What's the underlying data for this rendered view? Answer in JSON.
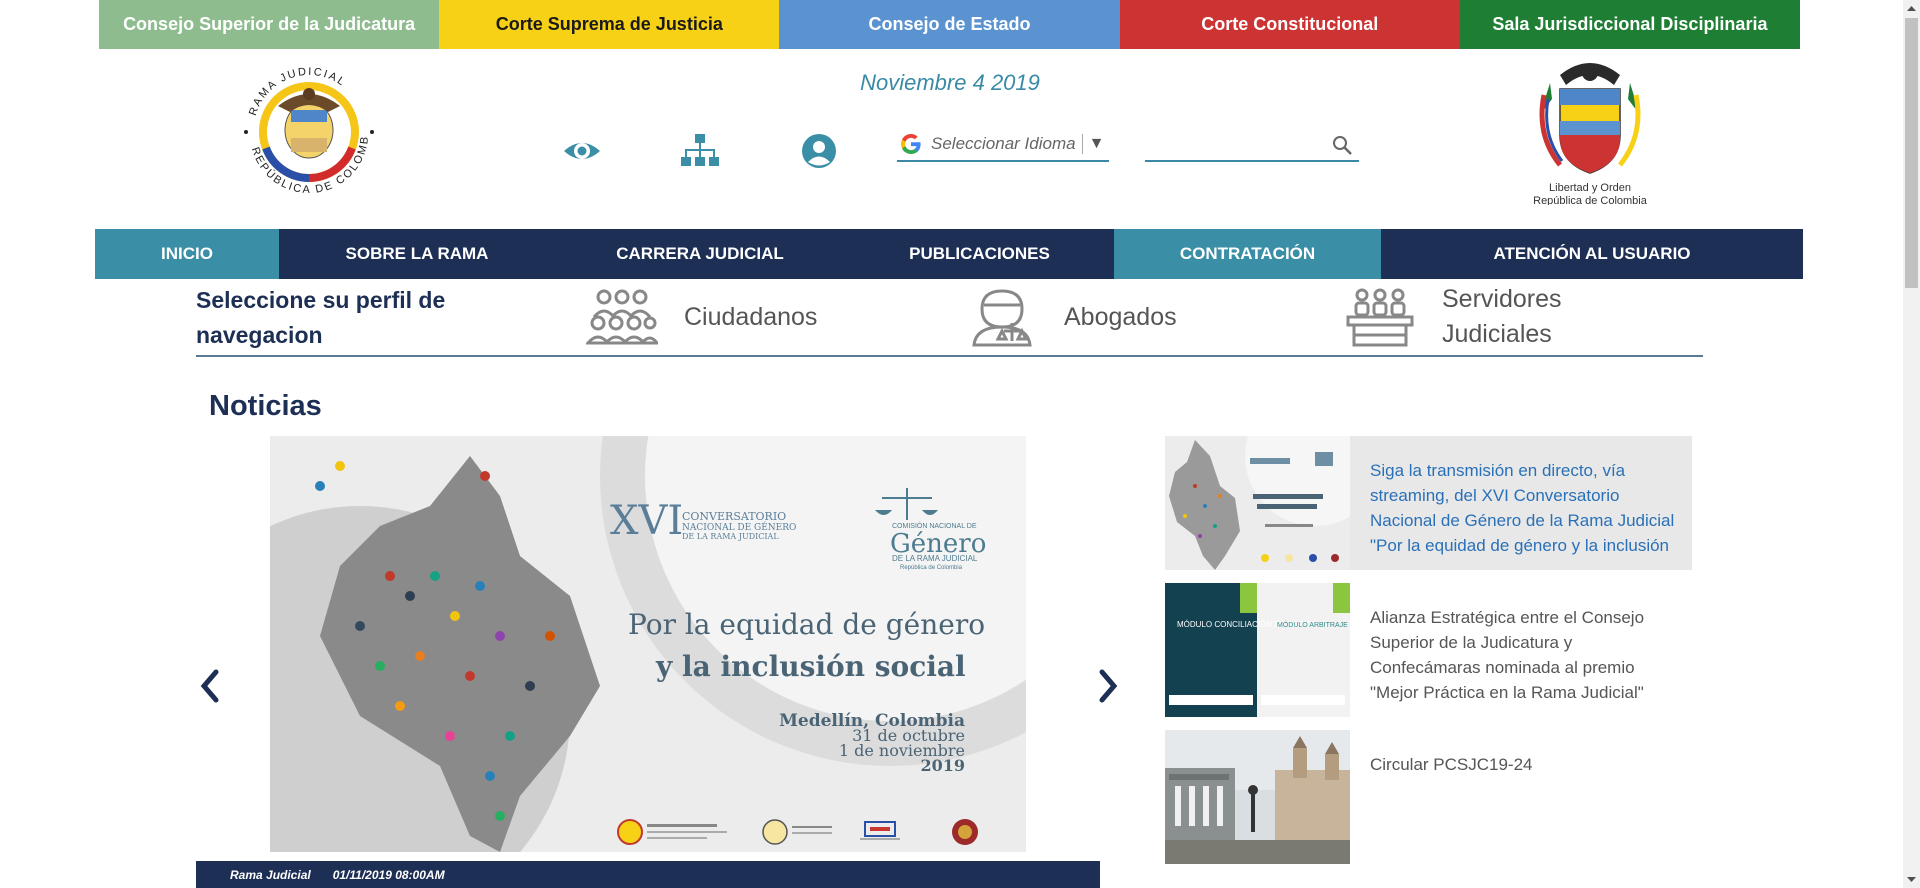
{
  "courts": [
    {
      "label": "Consejo Superior de la Judicatura"
    },
    {
      "label": "Corte Suprema de Justicia"
    },
    {
      "label": "Consejo de Estado"
    },
    {
      "label": "Corte Constitucional"
    },
    {
      "label": "Sala Jurisdiccional Disciplinaria"
    }
  ],
  "header": {
    "date": "Noviembre 4 2019",
    "logo_left_text": "RAMA JUDICIAL · REPÚBLICA DE COLOMBIA",
    "logo_right_line1": "Libertad y Orden",
    "logo_right_line2": "República de Colombia",
    "language_placeholder": "Seleccionar Idioma",
    "search_placeholder": ""
  },
  "nav": [
    {
      "label": "INICIO"
    },
    {
      "label": "SOBRE LA RAMA"
    },
    {
      "label": "CARRERA JUDICIAL"
    },
    {
      "label": "PUBLICACIONES"
    },
    {
      "label": "CONTRATACIÓN"
    },
    {
      "label": "ATENCIÓN AL USUARIO"
    }
  ],
  "profile": {
    "title": "Seleccione su perfil de navegacion",
    "options": [
      {
        "label": "Ciudadanos"
      },
      {
        "label": "Abogados"
      },
      {
        "label": "Servidores Judiciales"
      }
    ]
  },
  "news": {
    "title": "Noticias",
    "slide": {
      "event_roman": "XVI",
      "event_line1": "CONVERSATORIO",
      "event_line2": "NACIONAL DE GÉNERO",
      "event_line3": "DE LA RAMA JUDICIAL",
      "commission_small": "COMISIÓN NACIONAL DE",
      "commission_big": "Género",
      "commission_line": "DE LA RAMA JUDICIAL",
      "commission_country": "República de Colombia",
      "headline1": "Por la equidad de género",
      "headline2": "y la inclusión social",
      "place": "Medellín, Colombia",
      "date1": "31 de octubre",
      "date2": "1 de noviembre",
      "year": "2019"
    },
    "caption_source": "Rama Judicial",
    "caption_datetime": "01/11/2019 08:00AM",
    "items": [
      {
        "title": "Siga la transmisión en directo, vía streaming, del XVI Conversatorio Nacional de Género de la Rama Judicial \"Por la equidad de género y la inclusión social\""
      },
      {
        "title": "Alianza Estratégica entre el Consejo Superior de la Judicatura y Confecámaras nominada al premio \"Mejor Práctica en la Rama Judicial\""
      },
      {
        "title": "Circular PCSJC19-24"
      }
    ],
    "thumb2_left": "MÓDULO CONCILIACIÓN EN DERECHO",
    "thumb2_right": "MÓDULO ARBITRAJE NACIONAL E INTERNACIONAL"
  },
  "colors": {
    "navy": "#1d2f55",
    "teal": "#3a8ea6",
    "court_green_light": "#8fbc8f",
    "court_yellow": "#f7d116",
    "court_blue": "#5b92d0",
    "court_red": "#cc3333",
    "court_green": "#1e7e34"
  }
}
